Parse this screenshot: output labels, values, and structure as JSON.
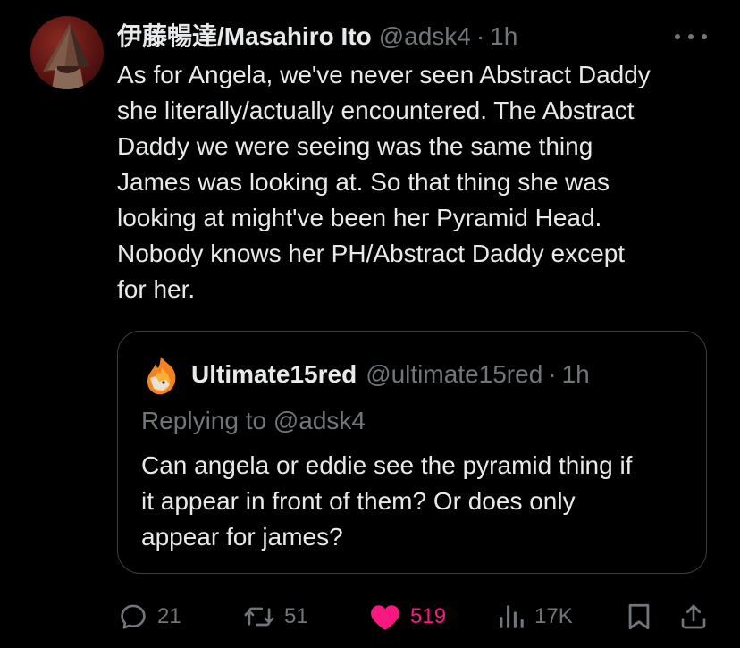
{
  "tweet": {
    "author": {
      "display_name": "伊藤暢達/Masahiro Ito",
      "handle": "@adsk4",
      "separator": "·",
      "time": "1h",
      "avatar_icon": "pyramid-head-avatar"
    },
    "more_icon": "more-dots-icon",
    "text_lines": [
      "As for Angela, we've never seen Abstract Daddy",
      "she literally/actually encountered. The Abstract",
      "Daddy we were seeing was the same thing",
      "James was looking at. So that thing she was",
      "looking at might've been her Pyramid Head.",
      "Nobody knows her PH/Abstract Daddy except",
      "for her."
    ]
  },
  "quote": {
    "author": {
      "display_name": "Ultimate15red",
      "handle": "@ultimate15red",
      "separator": "·",
      "time": "1h",
      "avatar_icon": "flame-avatar"
    },
    "reply_line": "Replying to @adsk4",
    "text_lines": [
      "Can angela or eddie see the pyramid thing if",
      "it appear in front of them? Or does only",
      "appear for james?"
    ]
  },
  "actions": {
    "reply": {
      "icon": "reply-icon",
      "count": "21"
    },
    "retweet": {
      "icon": "retweet-icon",
      "count": "51"
    },
    "like": {
      "icon": "heart-icon",
      "count": "519",
      "active": true
    },
    "views": {
      "icon": "views-icon",
      "count": "17K"
    },
    "bookmark": {
      "icon": "bookmark-icon"
    },
    "share": {
      "icon": "share-icon"
    }
  },
  "colors": {
    "background": "#000000",
    "text": "#e7e9ea",
    "muted": "#71767b",
    "like": "#f91880",
    "border": "#3a3d41"
  }
}
